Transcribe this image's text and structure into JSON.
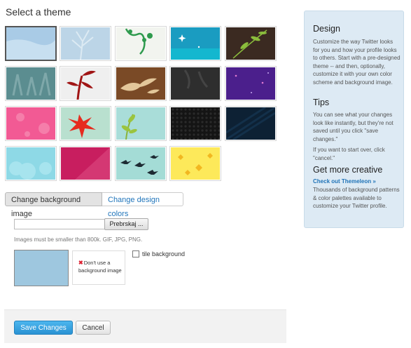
{
  "title": "Select a theme",
  "themes": [
    {
      "icon": "theme-sky-blue",
      "selected": true
    },
    {
      "icon": "theme-blue-tree"
    },
    {
      "icon": "theme-green-vine"
    },
    {
      "icon": "theme-teal-sparkle"
    },
    {
      "icon": "theme-dark-leaves"
    },
    {
      "icon": "theme-teal-pattern"
    },
    {
      "icon": "theme-red-plant"
    },
    {
      "icon": "theme-brown-birds"
    },
    {
      "icon": "theme-dark-gray"
    },
    {
      "icon": "theme-purple-sparkle"
    },
    {
      "icon": "theme-pink-flowers"
    },
    {
      "icon": "theme-red-flower"
    },
    {
      "icon": "theme-green-leaves"
    },
    {
      "icon": "theme-black-hex"
    },
    {
      "icon": "theme-dark-navy"
    },
    {
      "icon": "theme-cloud-blue"
    },
    {
      "icon": "theme-magenta-pink"
    },
    {
      "icon": "theme-birds-branch"
    },
    {
      "icon": "theme-yellow-leaves"
    }
  ],
  "tabs": {
    "background": "Change background image",
    "colors": "Change design colors"
  },
  "upload": {
    "file_value": "",
    "browse_label": "Prebrskaj ...",
    "hint": "Images must be smaller than 800k. GIF, JPG, PNG.",
    "current_bg_color": "#9ec7df",
    "no_bg_label_1": "Don't use a",
    "no_bg_label_2": "background image",
    "tile_label": "tile background",
    "tile_checked": false
  },
  "footer": {
    "save": "Save Changes",
    "cancel": "Cancel"
  },
  "panel": {
    "design_title": "Design",
    "design_text": "Customize the way Twitter looks for you and how your profile looks to others. Start with a pre-designed theme -- and then, optionally, customize it with your own color scheme and background image.",
    "tips_title": "Tips",
    "tips_text_1": "You can see what your changes look like instantly, but they're not saved until you click \"save changes.\"",
    "tips_text_2": "If you want to start over, click \"cancel.\"",
    "creative_title": "Get more creative",
    "creative_link": "Check out Themeleon »",
    "creative_text": "Thousands of background patterns & color palettes available to customize your Twitter profile."
  },
  "colors": {
    "accent": "#2a92d3",
    "link": "#1f73b7",
    "panel_bg": "#ddeaf4"
  }
}
